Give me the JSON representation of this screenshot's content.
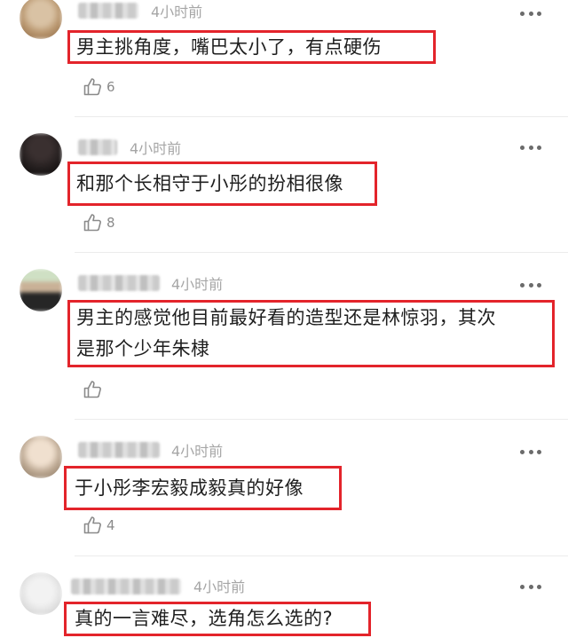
{
  "comments": [
    {
      "time": "4小时前",
      "text": "男主挑角度，嘴巴太小了，有点硬伤",
      "likes": "6"
    },
    {
      "time": "4小时前",
      "text": "和那个长相守于小彤的扮相很像",
      "likes": "8"
    },
    {
      "time": "4小时前",
      "text_line1": "男主的感觉他目前最好看的造型还是林惊羽，其次",
      "text_line2": "是那个少年朱棣",
      "likes": ""
    },
    {
      "time": "4小时前",
      "text": "于小彤李宏毅成毅真的好像",
      "likes": "4"
    },
    {
      "time": "4小时前",
      "text": "真的一言难尽，选角怎么选的?"
    }
  ],
  "colors": {
    "highlight_border": "#e3242b",
    "meta_text": "#a6a6a6"
  },
  "icons": {
    "like": "thumbs-up-icon",
    "more": "more-dots-icon"
  }
}
